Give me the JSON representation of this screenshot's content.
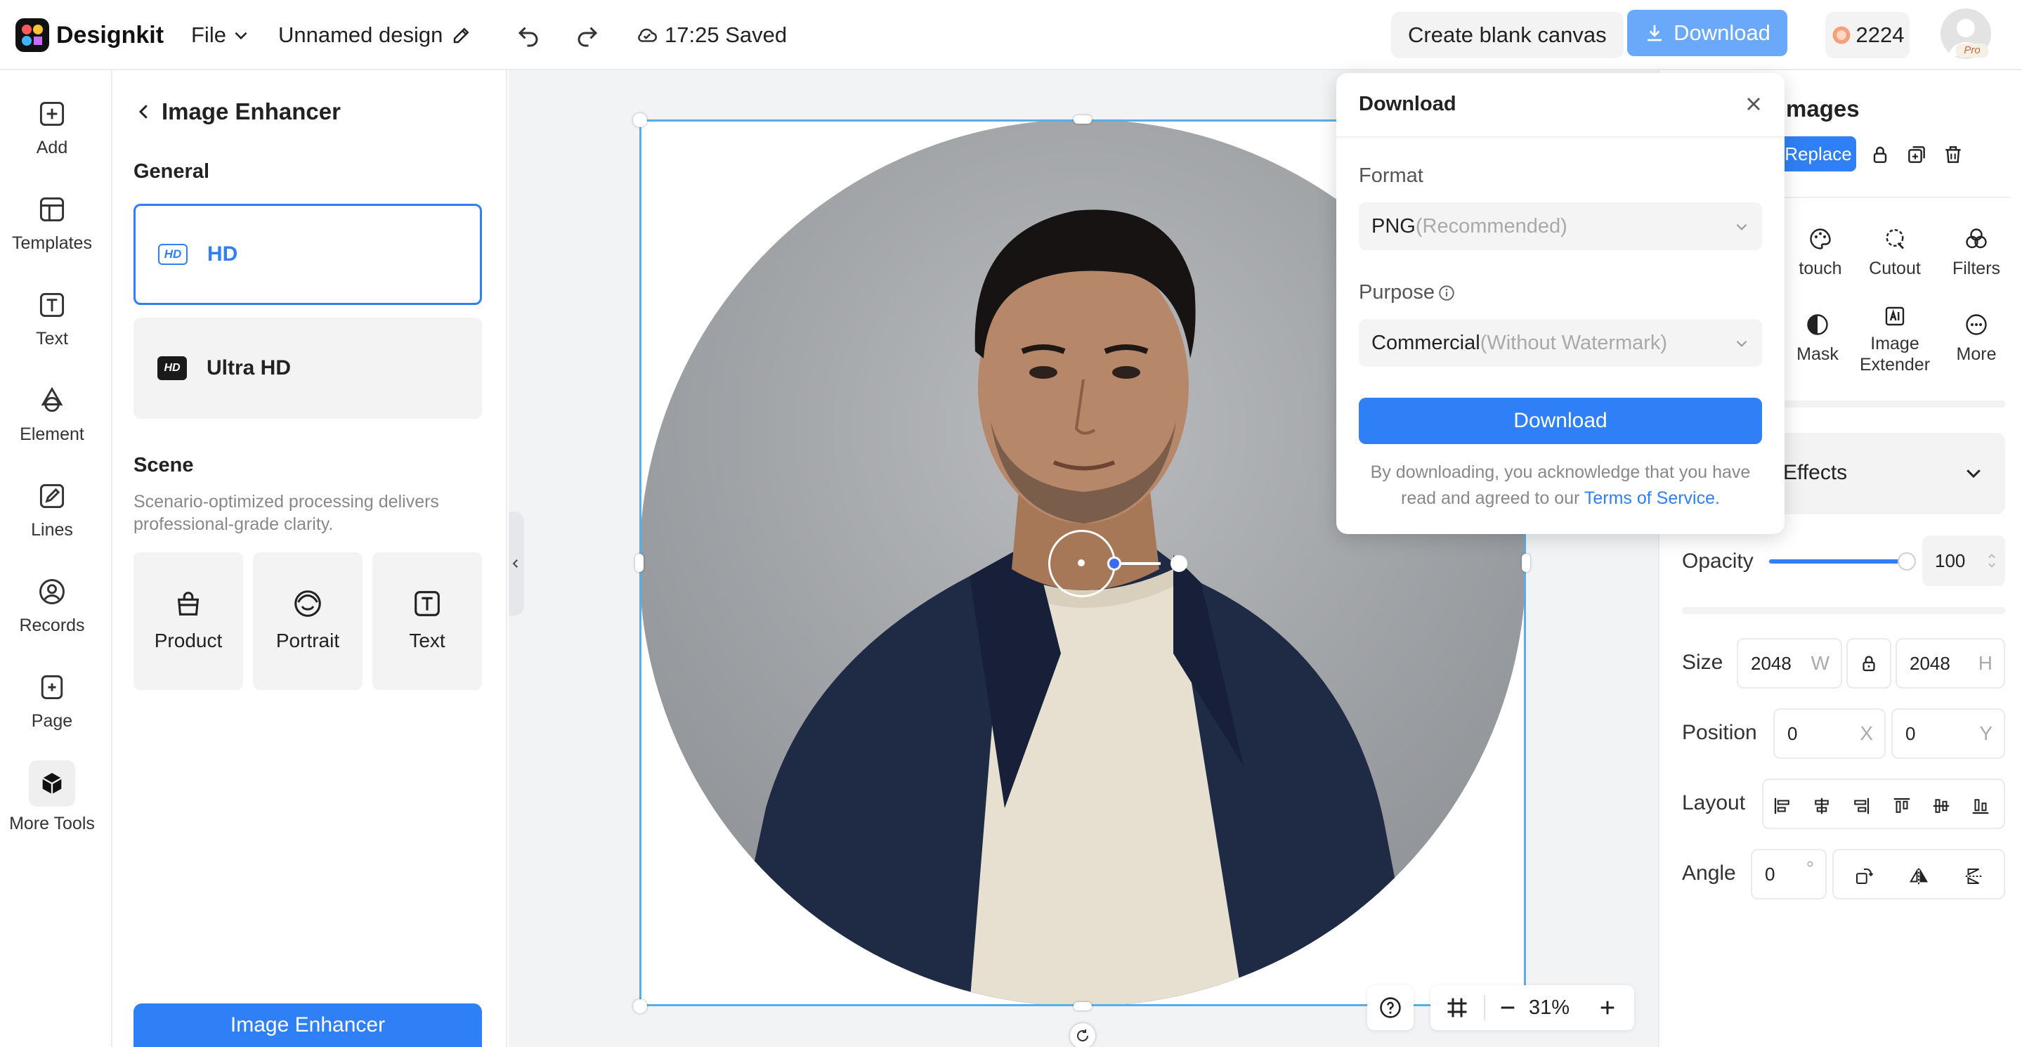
{
  "app": {
    "name": "Designkit"
  },
  "topbar": {
    "file_label": "File",
    "design_name": "Unnamed design",
    "save_status": "17:25 Saved",
    "create_blank_label": "Create blank canvas",
    "download_label": "Download",
    "credits": "2224",
    "avatar_badge": "Pro"
  },
  "rail": {
    "items": [
      {
        "label": "Add",
        "icon": "plus-square-icon"
      },
      {
        "label": "Templates",
        "icon": "templates-icon"
      },
      {
        "label": "Text",
        "icon": "text-icon"
      },
      {
        "label": "Element",
        "icon": "element-icon"
      },
      {
        "label": "Lines",
        "icon": "pen-icon"
      },
      {
        "label": "Records",
        "icon": "user-circle-icon"
      },
      {
        "label": "Page",
        "icon": "page-add-icon"
      },
      {
        "label": "More Tools",
        "icon": "box-icon"
      }
    ]
  },
  "left_panel": {
    "title": "Image Enhancer",
    "general_heading": "General",
    "options": [
      {
        "label": "HD",
        "badge": "HD",
        "selected": true
      },
      {
        "label": "Ultra HD",
        "badge": "HD",
        "selected": false
      }
    ],
    "scene_heading": "Scene",
    "scene_desc": "Scenario-optimized processing delivers professional-grade clarity.",
    "scenes": [
      {
        "label": "Product",
        "icon": "bag-icon"
      },
      {
        "label": "Portrait",
        "icon": "portrait-icon"
      },
      {
        "label": "Text",
        "icon": "text-box-icon"
      }
    ],
    "action_label": "Image Enhancer"
  },
  "canvas": {
    "zoom": "31%"
  },
  "right_panel": {
    "title_fragment": "mages",
    "replace_label": "Replace",
    "tools": [
      {
        "label": "touch",
        "icon": "palette-icon"
      },
      {
        "label": "Cutout",
        "icon": "cutout-icon"
      },
      {
        "label": "Filters",
        "icon": "filters-icon"
      },
      {
        "label": "Mask",
        "icon": "mask-icon"
      },
      {
        "label": "Image Extender",
        "icon": "ai-extender-icon"
      },
      {
        "label": "More",
        "icon": "more-icon"
      }
    ],
    "effects_label": "Effects",
    "opacity_label": "Opacity",
    "opacity_value": "100",
    "opacity_fraction": 1.0,
    "size_label": "Size",
    "width": "2048",
    "width_unit": "W",
    "height": "2048",
    "height_unit": "H",
    "position_label": "Position",
    "pos_x": "0",
    "pos_x_unit": "X",
    "pos_y": "0",
    "pos_y_unit": "Y",
    "layout_label": "Layout",
    "angle_label": "Angle",
    "angle_value": "0",
    "angle_unit": "°"
  },
  "download_popup": {
    "title": "Download",
    "format_label": "Format",
    "format_value": "PNG",
    "format_hint": "(Recommended)",
    "purpose_label": "Purpose",
    "purpose_value": "Commercial",
    "purpose_hint": "(Without Watermark)",
    "download_button": "Download",
    "notice_prefix": "By downloading, you acknowledge that you have read and agreed to our ",
    "tos_link": "Terms of Service",
    "notice_suffix": "."
  },
  "colors": {
    "accent": "#2f80f6",
    "download_btn_light": "#6aa9fa",
    "selection_border": "#5aaee8"
  }
}
